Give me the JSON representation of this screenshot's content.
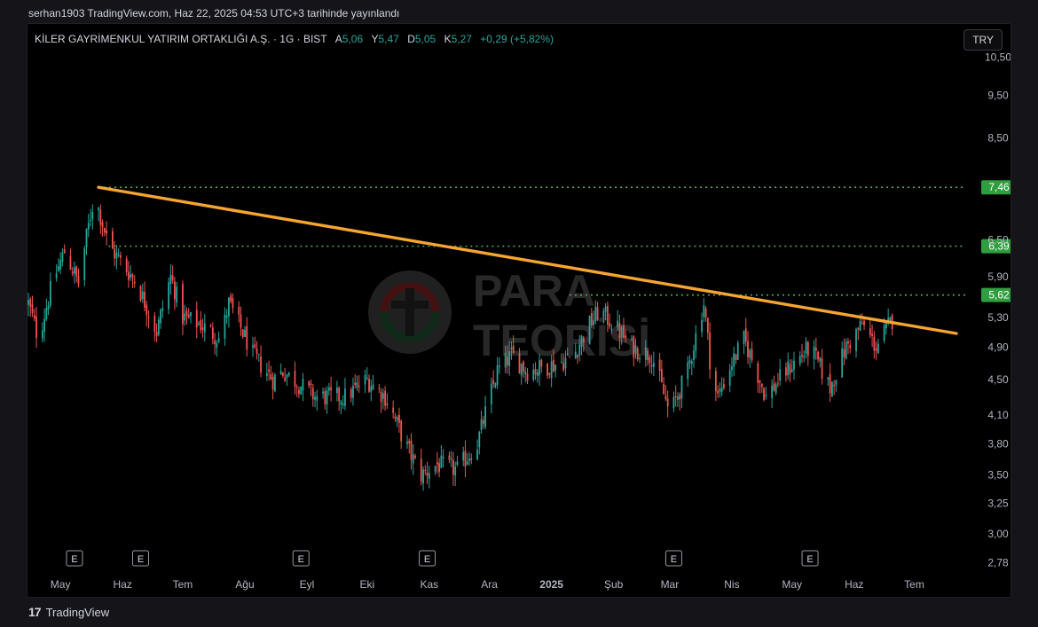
{
  "caption": "serhan1903 TradingView.com, Haz 22, 2025 04:53 UTC+3 tarihinde yayınlandı",
  "symbol": {
    "name": "KİLER GAYRİMENKUL YATIRIM ORTAKLIĞI A.Ş. · 1G · BIST",
    "open_label": "A",
    "open": "5,06",
    "high_label": "Y",
    "high": "5,47",
    "low_label": "D",
    "low": "5,05",
    "close_label": "K",
    "close": "5,27",
    "change": "+0,29 (+5,82%)"
  },
  "currency": "TRY",
  "watermark": {
    "line1": "PARA",
    "line2": "TEORİSİ"
  },
  "footer": {
    "brand": "TradingView",
    "logo": "17"
  },
  "colors": {
    "up": "#26a69a",
    "down": "#ef5350",
    "trendline": "#f7a531",
    "level": "#4caf50",
    "background": "#000000",
    "axis_text": "#b2b5be"
  },
  "chart_data": {
    "type": "candlestick",
    "y_scale": "log",
    "ylim": [
      2.7,
      11.2
    ],
    "y_ticks": [
      "10,50",
      "9,50",
      "8,50",
      "6,50",
      "5,90",
      "5,30",
      "4,90",
      "4,50",
      "4,10",
      "3,80",
      "3,50",
      "3,25",
      "3,00",
      "2,78"
    ],
    "y_tick_values": [
      10.5,
      9.5,
      8.5,
      6.5,
      5.9,
      5.3,
      4.9,
      4.5,
      4.1,
      3.8,
      3.5,
      3.25,
      3.0,
      2.78
    ],
    "x_ticks": [
      "May",
      "Haz",
      "Tem",
      "Ağu",
      "Eyl",
      "Eki",
      "Kas",
      "Ara",
      "2025",
      "Şub",
      "Mar",
      "Nis",
      "May",
      "Haz",
      "Tem"
    ],
    "x_tick_dates": [
      "2024-05-01",
      "2024-06-01",
      "2024-07-01",
      "2024-08-01",
      "2024-09-01",
      "2024-10-01",
      "2024-11-01",
      "2024-12-01",
      "2025-01-01",
      "2025-02-01",
      "2025-03-01",
      "2025-04-01",
      "2025-05-01",
      "2025-06-01",
      "2025-07-01"
    ],
    "x_range": [
      "2024-04-15",
      "2025-07-26"
    ],
    "earnings_markers": [
      {
        "date": "2024-05-08",
        "label": "E"
      },
      {
        "date": "2024-06-10",
        "label": "E"
      },
      {
        "date": "2024-08-29",
        "label": "E"
      },
      {
        "date": "2024-10-31",
        "label": "E"
      },
      {
        "date": "2025-03-03",
        "label": "E"
      },
      {
        "date": "2025-05-10",
        "label": "E"
      }
    ],
    "price_levels": [
      {
        "value": 7.46,
        "label": "7,46",
        "start": "2024-05-20"
      },
      {
        "value": 6.39,
        "label": "6,39",
        "start": "2024-05-25"
      },
      {
        "value": 5.62,
        "label": "5,62",
        "start": "2025-01-10"
      }
    ],
    "trendline": {
      "start": {
        "date": "2024-05-20",
        "value": 7.46
      },
      "end": {
        "date": "2025-07-22",
        "value": 5.08
      }
    },
    "anchors": [
      [
        "2024-04-15",
        5.5
      ],
      [
        "2024-04-20",
        5.0
      ],
      [
        "2024-04-27",
        5.8
      ],
      [
        "2024-05-03",
        6.3
      ],
      [
        "2024-05-10",
        5.8
      ],
      [
        "2024-05-18",
        7.3
      ],
      [
        "2024-05-25",
        6.4
      ],
      [
        "2024-06-08",
        5.8
      ],
      [
        "2024-06-18",
        5.1
      ],
      [
        "2024-06-25",
        5.9
      ],
      [
        "2024-07-01",
        5.3
      ],
      [
        "2024-07-10",
        5.2
      ],
      [
        "2024-07-20",
        5.0
      ],
      [
        "2024-07-24",
        5.5
      ],
      [
        "2024-08-05",
        4.8
      ],
      [
        "2024-08-15",
        4.5
      ],
      [
        "2024-08-20",
        4.6
      ],
      [
        "2024-09-05",
        4.3
      ],
      [
        "2024-09-20",
        4.3
      ],
      [
        "2024-10-01",
        4.5
      ],
      [
        "2024-10-10",
        4.3
      ],
      [
        "2024-10-20",
        3.8
      ],
      [
        "2024-10-28",
        3.5
      ],
      [
        "2024-11-05",
        3.6
      ],
      [
        "2024-11-15",
        3.55
      ],
      [
        "2024-11-25",
        3.8
      ],
      [
        "2024-12-05",
        4.6
      ],
      [
        "2024-12-12",
        4.8
      ],
      [
        "2024-12-20",
        4.6
      ],
      [
        "2025-01-05",
        4.7
      ],
      [
        "2025-01-12",
        4.8
      ],
      [
        "2025-01-20",
        5.2
      ],
      [
        "2025-01-25",
        5.4
      ],
      [
        "2025-02-01",
        5.2
      ],
      [
        "2025-02-10",
        4.9
      ],
      [
        "2025-02-20",
        4.8
      ],
      [
        "2025-03-01",
        4.1
      ],
      [
        "2025-03-10",
        4.6
      ],
      [
        "2025-03-18",
        5.5
      ],
      [
        "2025-03-22",
        4.5
      ],
      [
        "2025-03-25",
        4.3
      ],
      [
        "2025-04-01",
        4.7
      ],
      [
        "2025-04-07",
        5.0
      ],
      [
        "2025-04-18",
        4.3
      ],
      [
        "2025-04-28",
        4.6
      ],
      [
        "2025-05-10",
        4.9
      ],
      [
        "2025-05-20",
        4.4
      ],
      [
        "2025-05-28",
        4.9
      ],
      [
        "2025-06-05",
        5.2
      ],
      [
        "2025-06-12",
        4.9
      ],
      [
        "2025-06-20",
        5.27
      ]
    ]
  }
}
